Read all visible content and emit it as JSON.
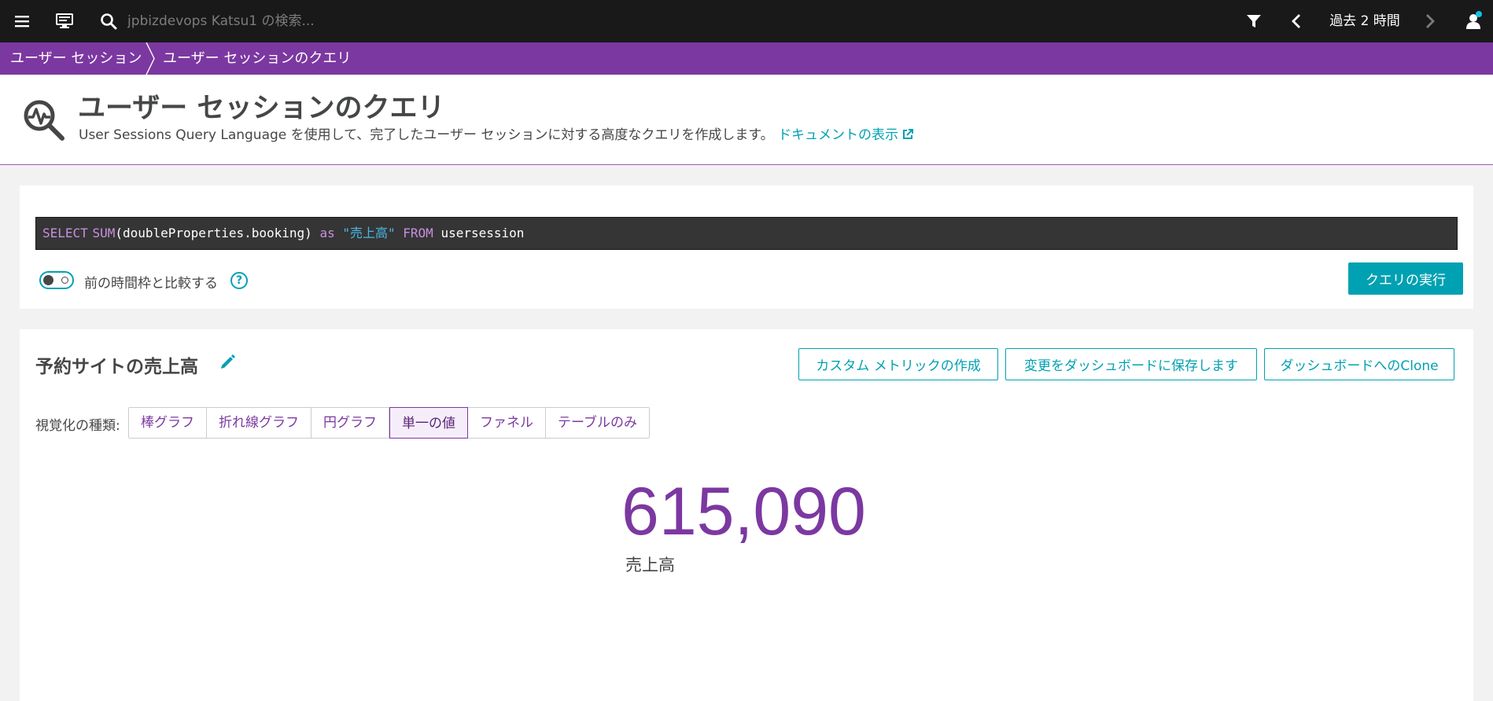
{
  "topbar": {
    "search_placeholder": "jpbizdevops Katsu1 の検索...",
    "timeframe": "過去 2 時間"
  },
  "breadcrumb": {
    "items": [
      "ユーザー セッション",
      "ユーザー セッションのクエリ"
    ]
  },
  "header": {
    "title": "ユーザー セッションのクエリ",
    "description": "User Sessions Query Language を使用して、完了したユーザー セッションに対する高度なクエリを作成します。",
    "doc_link": "ドキュメントの表示"
  },
  "query": {
    "tokens": {
      "select": "SELECT",
      "sum": "SUM",
      "arg": "(doubleProperties.booking)",
      "as": "as",
      "alias": "\"売上高\"",
      "from": "FROM",
      "table": "usersession"
    },
    "compare_label": "前の時間枠と比較する",
    "compare_enabled": false,
    "help": "?",
    "run_button": "クエリの実行"
  },
  "result": {
    "title": "予約サイトの売上高",
    "buttons": {
      "custom_metric": "カスタム メトリックの作成",
      "save_dashboard": "変更をダッシュボードに保存します",
      "clone_dashboard": "ダッシュボードへのClone"
    },
    "viz_label": "視覚化の種類:",
    "viz_types": [
      "棒グラフ",
      "折れ線グラフ",
      "円グラフ",
      "単一の値",
      "ファネル",
      "テーブルのみ"
    ],
    "viz_selected": "単一の値",
    "value": "615,090",
    "value_label": "売上高"
  },
  "colors": {
    "brand_purple": "#7c38a1",
    "accent_teal": "#00a1b2",
    "topbar": "#191919"
  }
}
